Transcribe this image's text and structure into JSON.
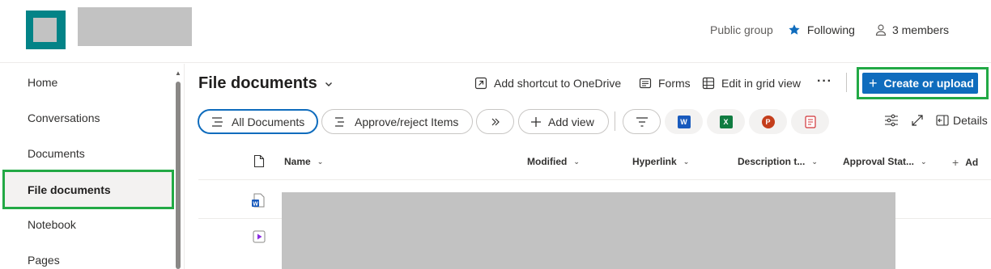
{
  "header": {
    "privacy": "Public group",
    "following": "Following",
    "members": "3 members"
  },
  "leftnav": {
    "items": [
      "Home",
      "Conversations",
      "Documents",
      "File documents",
      "Notebook",
      "Pages"
    ]
  },
  "commandbar": {
    "title": "File documents",
    "add_shortcut": "Add shortcut to OneDrive",
    "forms": "Forms",
    "grid_view": "Edit in grid view",
    "more": "···",
    "create": "Create or upload"
  },
  "views": {
    "all_documents": "All Documents",
    "approve": "Approve/reject Items",
    "add_view": "Add view",
    "details": "Details"
  },
  "apps": [
    {
      "name": "word-icon",
      "letter": "W",
      "color": "#185abd"
    },
    {
      "name": "excel-icon",
      "letter": "X",
      "color": "#107c41"
    },
    {
      "name": "powerpoint-icon",
      "letter": "P",
      "color": "#c43e1c"
    },
    {
      "name": "forms-icon",
      "letter": "",
      "color": "#d13438"
    }
  ],
  "columns": [
    "Name",
    "Modified",
    "Hyperlink",
    "Description t...",
    "Approval Stat...",
    "Ad"
  ],
  "colors": {
    "accent": "#0f6cbd",
    "highlight": "#22a945",
    "site_logo": "#038387"
  }
}
